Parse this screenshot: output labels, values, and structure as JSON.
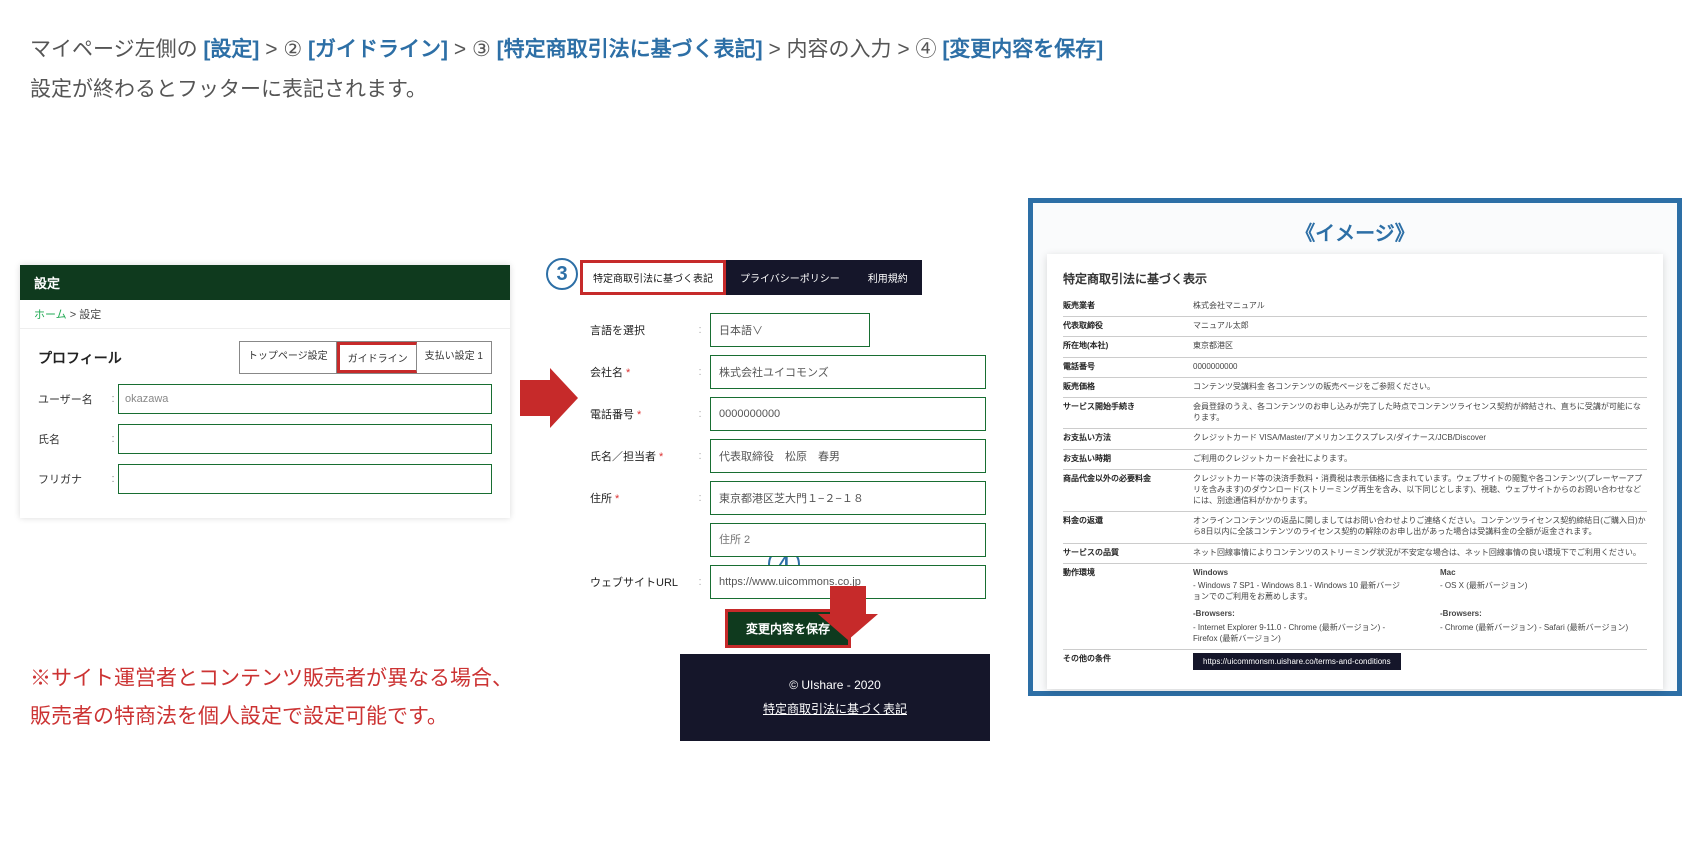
{
  "instructions": {
    "pre": "マイページ左側の ",
    "b1": "[設定]",
    "sep1": " > ② ",
    "b2": "[ガイドライン]",
    "sep2": " > ③ ",
    "b3": "[特定商取引法に基づく表記]",
    "sep3": " > 内容の入力 > ④ ",
    "b4": "[変更内容を保存]",
    "line2": "設定が終わるとフッターに表記されます。"
  },
  "note": {
    "l1": "※サイト運営者とコンテンツ販売者が異なる場合、",
    "l2": "販売者の特商法を個人設定で設定可能です。"
  },
  "circles": {
    "c2": "2",
    "c3": "3",
    "c4": "4"
  },
  "panel1": {
    "header": "設定",
    "crumb_home": "ホーム",
    "crumb_sep": " > ",
    "crumb_cur": "設定",
    "profile_title": "プロフィール",
    "tab_top": "トップページ設定",
    "tab_guide": "ガイドライン",
    "tab_pay": "支払い設定 1",
    "f_user_lbl": "ユーザー名",
    "f_user_val": "okazawa",
    "f_name_lbl": "氏名",
    "f_kana_lbl": "フリガナ",
    "colon": ":"
  },
  "panel2": {
    "tab_act": "特定商取引法に基づく表記",
    "tab_pp": "プライバシーポリシー",
    "tab_tos": "利用規約",
    "f_lang_lbl": "言語を選択",
    "f_lang_val": "日本語∨",
    "f_company_lbl": "会社名",
    "f_company_val": "株式会社ユイコモンズ",
    "f_tel_lbl": "電話番号",
    "f_tel_val": "0000000000",
    "f_rep_lbl": "氏名／担当者",
    "f_rep_val": "代表取締役　松原　春男",
    "f_addr_lbl": "住所",
    "f_addr_val": "東京都港区芝大門１−２−１８",
    "f_addr2_ph": "住所 2",
    "f_url_lbl": "ウェブサイトURL",
    "f_url_val": "https://www.uicommons.co.jp",
    "req": " *",
    "colon": ":",
    "save": "変更内容を保存"
  },
  "footer": {
    "copy": "© UIshare - 2020",
    "link": "特定商取引法に基づく表記"
  },
  "image": {
    "title": "《イメージ》",
    "doc_title": "特定商取引法に基づく表示",
    "rows": {
      "seller_k": "販売業者",
      "seller_v": "株式会社マニュアル",
      "rep_k": "代表取締役",
      "rep_v": "マニュアル太郎",
      "loc_k": "所在地(本社)",
      "loc_v": "東京都港区",
      "tel_k": "電話番号",
      "tel_v": "0000000000",
      "price_k": "販売価格",
      "price_v": "コンテンツ受講料金\n各コンテンツの販売ページをご参照ください。",
      "svc_k": "サービス開始手続き",
      "svc_v": "会員登録のうえ、各コンテンツのお申し込みが完了した時点でコンテンツライセンス契約が締結され、直ちに受講が可能になります。",
      "pay_k": "お支払い方法",
      "pay_v": "クレジットカード\nVISA/Master/アメリカンエクスプレス/ダイナース/JCB/Discover",
      "paytime_k": "お支払い時期",
      "paytime_v": "ご利用のクレジットカード会社によります。",
      "extra_k": "商品代金以外の必要料金",
      "extra_v": "クレジットカード等の決済手数料・消費税は表示価格に含まれています。ウェブサイトの閲覧や各コンテンツ(プレーヤーアプリを含みます)のダウンロード(ストリーミング再生を含み、以下同じとします)、視聴、ウェブサイトからのお問い合わせなどには、別途通信料がかかります。",
      "refund_k": "料金の返還",
      "refund_v": "オンラインコンテンツの返品に関しましてはお問い合わせよりご連絡ください。コンテンツライセンス契約締結日(ご購入日)から8日以内に全該コンテンツのライセンス契約の解除のお申し出があった場合は受講料金の全額が返金されます。",
      "quality_k": "サービスの品質",
      "quality_v": "ネット回線事情によりコンテンツのストリーミング状況が不安定な場合は、ネット回線事情の良い環境下でご利用ください。",
      "env_k": "動作環境",
      "env_win_h": "Windows",
      "env_win_b": "- Windows 7 SP1\n- Windows 8.1\n- Windows 10\n最新バージョンでのご利用をお薦めします。",
      "env_mac_h": "Mac",
      "env_mac_b": "- OS X (最新バージョン)",
      "env_br1_h": "-Browsers:",
      "env_br1_b": "- Internet Explorer 9-11.0\n- Chrome (最新バージョン)\n- Firefox (最新バージョン)",
      "env_br2_h": "-Browsers:",
      "env_br2_b": "- Chrome (最新バージョン)\n- Safari (最新バージョン)",
      "other_k": "その他の条件",
      "other_url": "https://uicommonsm.uishare.co/terms-and-conditions"
    }
  }
}
